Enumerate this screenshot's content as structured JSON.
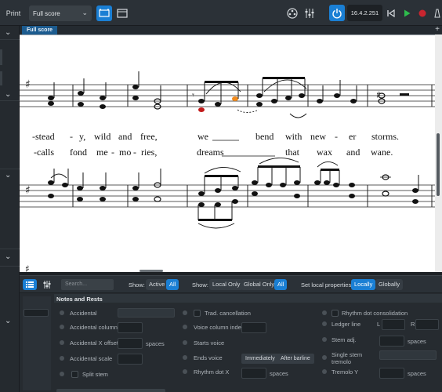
{
  "toolbar": {
    "print_label": "Print",
    "layout_dropdown": "Full score",
    "version": "16.4.2.251",
    "icons": [
      "galley-view-icon",
      "page-view-icon",
      "video-icon",
      "mixer-icon",
      "power-icon",
      "rewind-icon",
      "play-icon",
      "record-icon",
      "metronome-icon"
    ]
  },
  "score": {
    "tab_label": "Full score",
    "lyrics": {
      "line1": [
        "-stead",
        "-",
        "y,",
        "wild",
        "and",
        "free,",
        "we",
        "bend",
        "with",
        "new",
        "-",
        "er",
        "storms."
      ],
      "line2": [
        "-calls",
        "fond",
        "me",
        "-",
        "mo",
        "-",
        "ries,",
        "dreams",
        "that",
        "wax",
        "and",
        "wane."
      ]
    },
    "colors": {
      "selected_note": "#f08a1d",
      "colored_note": "#c21a1a",
      "accent": "#1a7fd4"
    }
  },
  "properties": {
    "search_placeholder": "Search...",
    "show_label": "Show:",
    "show_active": "Active",
    "show_all": "All",
    "show2_label": "Show:",
    "local_only": "Local Only",
    "global_only": "Global Only",
    "all2": "All",
    "set_local_label": "Set local properties:",
    "locally": "Locally",
    "globally": "Globally",
    "section_title": "Notes and Rests",
    "col1": [
      "Accidental",
      "Accidental column",
      "Accidental X offset",
      "Accidental scale",
      "Split stem"
    ],
    "col2": [
      "Trad. cancellation",
      "Voice column index",
      "Starts voice",
      "Ends voice",
      "Rhythm dot X"
    ],
    "col3": [
      "Rhythm dot consolidation",
      "Ledger line",
      "Stem adj.",
      "Single stem tremolo",
      "Tremolo Y"
    ],
    "spaces": "spaces",
    "ends_voice_buttons": [
      "Immediately",
      "After barline"
    ],
    "ledger_l": "L",
    "ledger_r": "R"
  }
}
